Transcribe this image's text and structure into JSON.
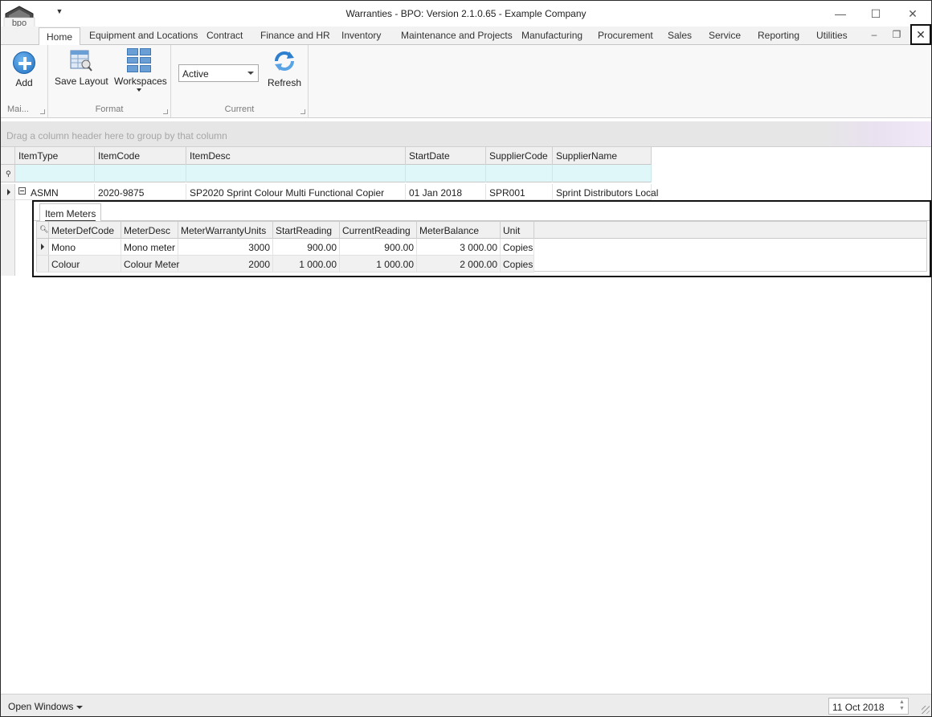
{
  "window": {
    "title": "Warranties - BPO: Version 2.1.0.65 - Example Company",
    "logo_text": "bpo"
  },
  "tabs": [
    "Home",
    "Equipment and Locations",
    "Contract",
    "Finance and HR",
    "Inventory",
    "Maintenance and Projects",
    "Manufacturing",
    "Procurement",
    "Sales",
    "Service",
    "Reporting",
    "Utilities"
  ],
  "ribbon": {
    "groups": {
      "main": {
        "label": "Mai...",
        "add_label": "Add"
      },
      "format": {
        "label": "Format",
        "save_layout_label": "Save Layout",
        "workspaces_label": "Workspaces"
      },
      "current": {
        "label": "Current",
        "status_value": "Active",
        "refresh_label": "Refresh"
      }
    }
  },
  "group_panel_hint": "Drag a column header here to group by that column",
  "grid": {
    "columns": [
      "ItemType",
      "ItemCode",
      "ItemDesc",
      "StartDate",
      "SupplierCode",
      "SupplierName"
    ],
    "rows": [
      {
        "ItemType": "ASMN",
        "ItemCode": "2020-9875",
        "ItemDesc": "SP2020 Sprint Colour Multi Functional Copier",
        "StartDate": "01 Jan 2018",
        "SupplierCode": "SPR001",
        "SupplierName": "Sprint Distributors Local"
      }
    ]
  },
  "detail": {
    "tab_label": "Item Meters",
    "columns": [
      "MeterDefCode",
      "MeterDesc",
      "MeterWarrantyUnits",
      "StartReading",
      "CurrentReading",
      "MeterBalance",
      "Unit"
    ],
    "rows": [
      [
        "Mono",
        "Mono meter",
        "3000",
        "900.00",
        "900.00",
        "3 000.00",
        "Copies"
      ],
      [
        "Colour",
        "Colour Meter",
        "2000",
        "1 000.00",
        "1 000.00",
        "2 000.00",
        "Copies"
      ]
    ]
  },
  "statusbar": {
    "open_windows_label": "Open Windows",
    "date": "11 Oct 2018"
  }
}
